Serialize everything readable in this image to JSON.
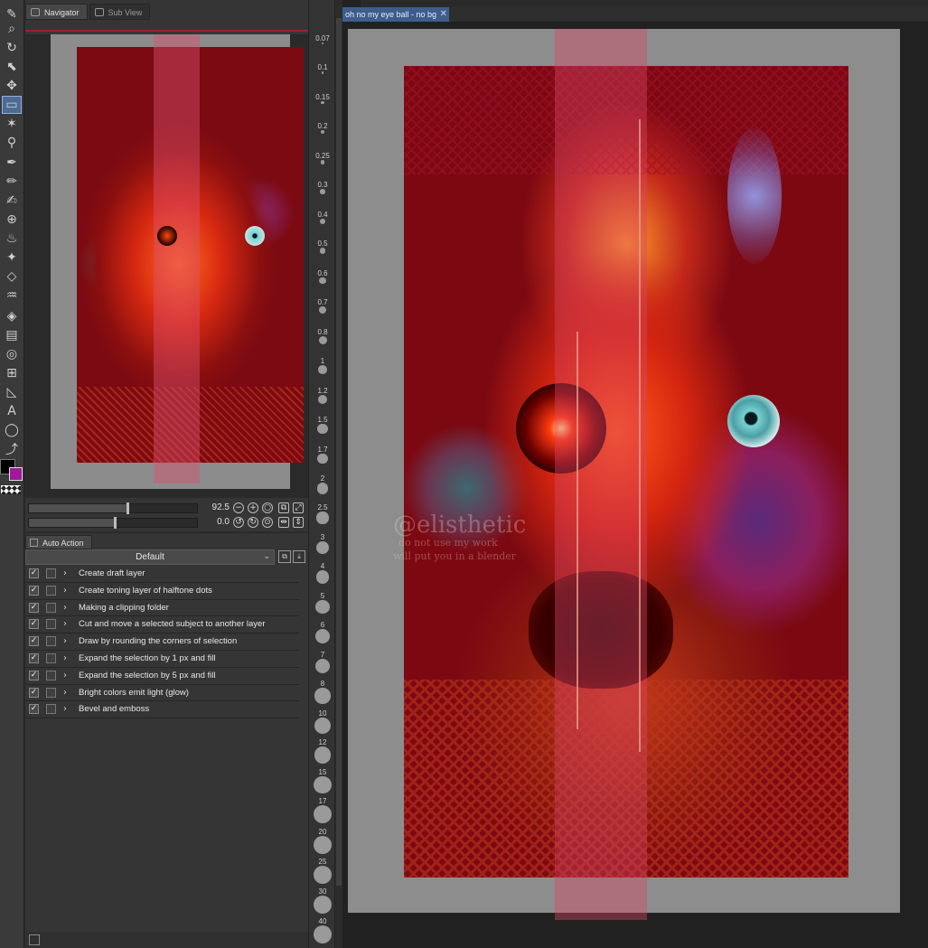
{
  "navigator": {
    "tabs": [
      {
        "label": "Navigator"
      },
      {
        "label": "Sub View"
      }
    ],
    "zoom_value": "92.5",
    "rotation_value": "0.0"
  },
  "auto_action": {
    "tab_label": "Auto Action",
    "set_name": "Default",
    "items": [
      {
        "label": "Create draft layer",
        "checked": true
      },
      {
        "label": "Create toning layer of halftone dots",
        "checked": true
      },
      {
        "label": "Making a clipping folder",
        "checked": true
      },
      {
        "label": "Cut and move a selected subject to another layer",
        "checked": true
      },
      {
        "label": "Draw by rounding the corners of selection",
        "checked": true
      },
      {
        "label": "Expand the selection by 1 px and fill",
        "checked": true
      },
      {
        "label": "Expand the selection by 5 px and fill",
        "checked": true
      },
      {
        "label": "Bright colors emit light (glow)",
        "checked": true
      },
      {
        "label": "Bevel and emboss",
        "checked": true
      }
    ]
  },
  "brush_sizes": [
    "0.07",
    "0.1",
    "0.15",
    "0.2",
    "0.25",
    "0.3",
    "0.4",
    "0.5",
    "0.6",
    "0.7",
    "0.8",
    "1",
    "1.2",
    "1.5",
    "1.7",
    "2",
    "2.5",
    "3",
    "4",
    "5",
    "6",
    "7",
    "8",
    "10",
    "12",
    "15",
    "17",
    "20",
    "25",
    "30",
    "40"
  ],
  "document": {
    "tab_title": "oh no my eye ball - no bg",
    "close_glyph": "✕"
  },
  "watermark": {
    "line1": "@elisthetic",
    "line2": "do not use my work",
    "line3": "will put you in a blender"
  },
  "colors": {
    "main_color": "#000000",
    "sub_color": "#a0199c",
    "active_tab": "#3d5d8d",
    "canvas_background": "#7c0912"
  },
  "tools": [
    {
      "icon": "pen-tool-icon"
    },
    {
      "icon": "zoom-icon"
    },
    {
      "icon": "rotate-view-icon"
    },
    {
      "icon": "operation-icon"
    },
    {
      "icon": "move-layer-icon"
    },
    {
      "icon": "selection-icon"
    },
    {
      "icon": "auto-select-icon"
    },
    {
      "icon": "eyedropper-icon"
    },
    {
      "icon": "pen-icon"
    },
    {
      "icon": "pencil-icon"
    },
    {
      "icon": "brush-icon"
    },
    {
      "icon": "perspective-icon"
    },
    {
      "icon": "airbrush-icon"
    },
    {
      "icon": "decoration-icon"
    },
    {
      "icon": "eraser-icon"
    },
    {
      "icon": "blend-icon"
    },
    {
      "icon": "fill-icon"
    },
    {
      "icon": "gradient-icon"
    },
    {
      "icon": "figure-icon"
    },
    {
      "icon": "frame-border-icon"
    },
    {
      "icon": "ruler-icon"
    },
    {
      "icon": "text-icon"
    },
    {
      "icon": "balloon-icon"
    },
    {
      "icon": "correct-line-icon"
    }
  ]
}
